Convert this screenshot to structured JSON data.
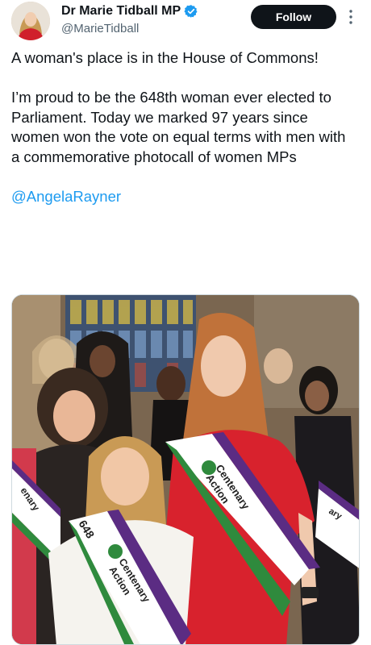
{
  "author": {
    "display_name": "Dr Marie Tidball MP",
    "handle": "@MarieTidball",
    "verified_icon": "verified-badge-icon",
    "colors": {
      "verified": "#1d9bf0"
    }
  },
  "actions": {
    "follow_label": "Follow",
    "more_icon": "more-options-icon"
  },
  "tweet": {
    "paragraph_1": "A woman's place is in the House of Commons!",
    "paragraph_2": "I’m proud to be the 648th woman ever elected to Parliament. Today we marked 97 years since women won the vote on equal terms with men with a commemorative photocall of women MPs",
    "mention": "@AngelaRayner"
  },
  "media": {
    "sashes": {
      "left_front": {
        "number": "648",
        "line_1": "Centenary",
        "line_2": "Action"
      },
      "right": {
        "line_1": "Centenary",
        "line_2": "Action"
      },
      "edge_left": "enary",
      "edge_right": "ary"
    }
  },
  "colors": {
    "link": "#1d9bf0",
    "button_bg": "#0f1419",
    "text": "#0f1419",
    "secondary": "#536471"
  }
}
